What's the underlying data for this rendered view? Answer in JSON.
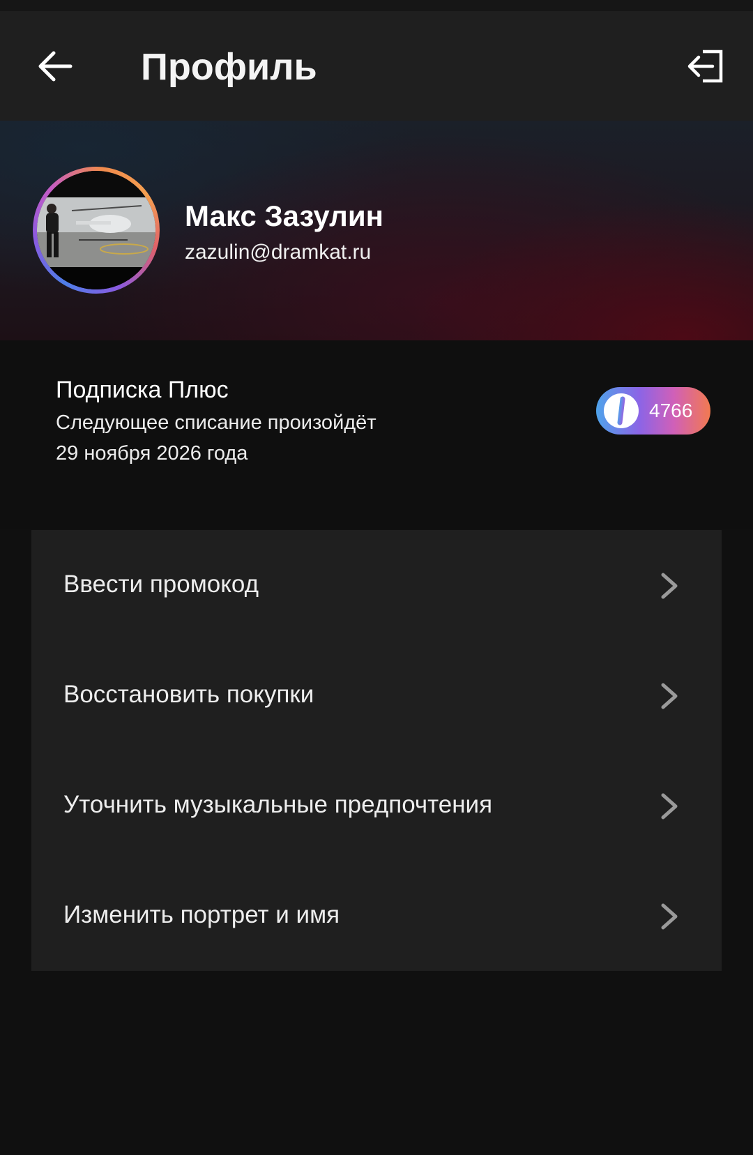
{
  "header": {
    "title": "Профиль",
    "back_icon": "arrow-left-icon",
    "logout_icon": "logout-icon"
  },
  "profile": {
    "name": "Макс Зазулин",
    "email": "zazulin@dramkat.ru"
  },
  "subscription": {
    "title": "Подписка Плюс",
    "line1": "Следующее списание произойдёт",
    "line2": "29 ноября 2026 года",
    "plus_points": "4766",
    "badge_colors": [
      "#4fa3ea",
      "#8c64e6",
      "#d060b8",
      "#f27a50"
    ]
  },
  "menu": {
    "items": [
      {
        "label": "Ввести промокод",
        "icon": "chevron-right-icon"
      },
      {
        "label": "Восстановить покупки",
        "icon": "chevron-right-icon"
      },
      {
        "label": "Уточнить музыкальные предпочтения",
        "icon": "chevron-right-icon"
      },
      {
        "label": "Изменить портрет и имя",
        "icon": "chevron-right-icon"
      }
    ]
  },
  "colors": {
    "background": "#101010",
    "header": "#1f1f1f",
    "card": "#1f1f1f",
    "text": "#ffffff",
    "chevron": "#9a9a9a"
  }
}
